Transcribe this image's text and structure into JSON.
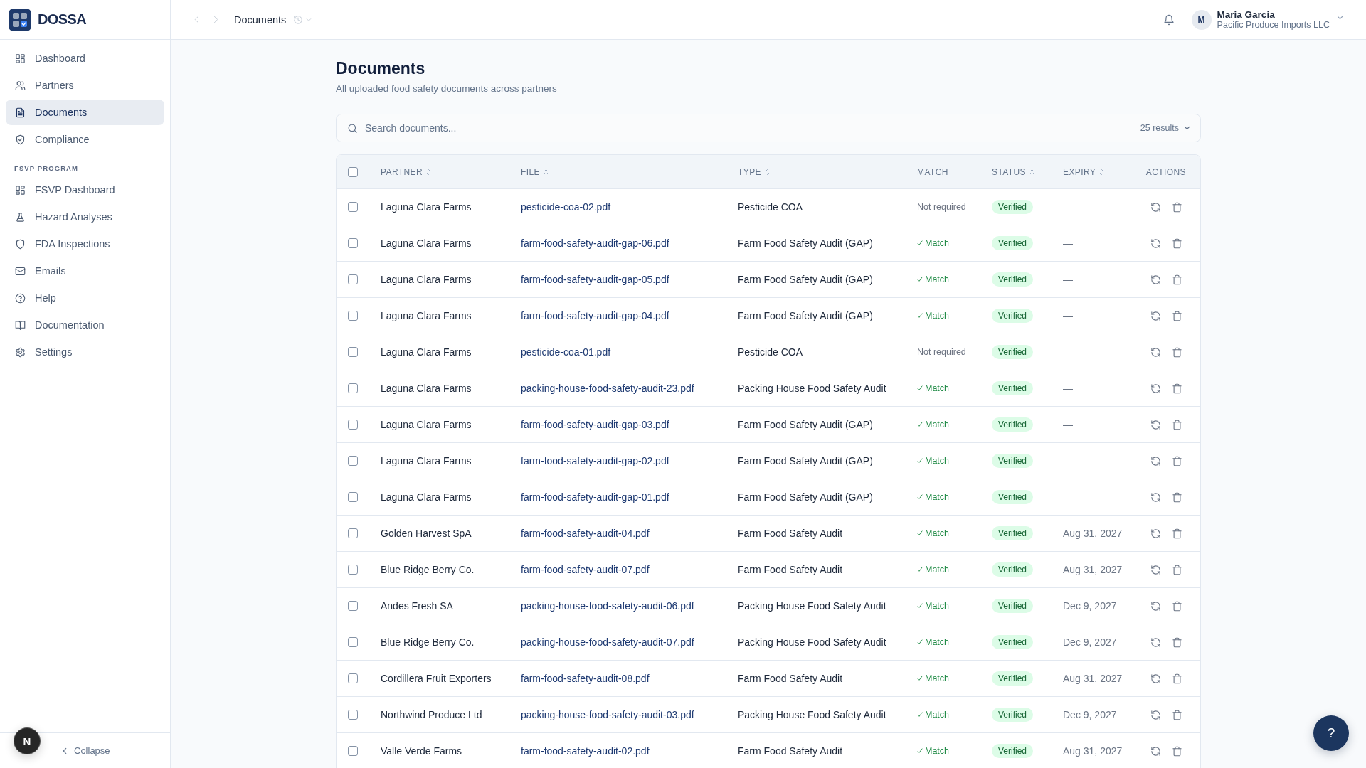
{
  "sidebar": {
    "logo": "DOSSA",
    "groups": [
      {
        "items": [
          {
            "label": "Dashboard",
            "selected": false
          },
          {
            "label": "Partners",
            "selected": false
          },
          {
            "label": "Documents",
            "selected": true
          },
          {
            "label": "Compliance",
            "selected": false
          }
        ]
      },
      {
        "label": "FSVP PROGRAM",
        "items": [
          {
            "label": "FSVP Dashboard",
            "selected": false
          },
          {
            "label": "Hazard Analyses",
            "selected": false
          },
          {
            "label": "FDA Inspections",
            "selected": false
          },
          {
            "label": "Emails",
            "selected": false
          },
          {
            "label": "Help",
            "selected": false
          },
          {
            "label": "Documentation",
            "selected": false
          },
          {
            "label": "Settings",
            "selected": false
          }
        ]
      }
    ],
    "collapse": "Collapse"
  },
  "header": {
    "breadcrumb": "Documents",
    "user": {
      "initial": "M",
      "name": "Maria Garcia",
      "organization": "Pacific Produce Imports LLC"
    }
  },
  "page": {
    "title": "Documents",
    "subtitle": "All uploaded food safety documents across partners"
  },
  "search": {
    "placeholder": "Search documents...",
    "results": "25 results"
  },
  "table": {
    "select_all_checked": false,
    "columns": [
      {
        "label": "PARTNER",
        "sortable": true
      },
      {
        "label": "FILE",
        "sortable": true
      },
      {
        "label": "TYPE",
        "sortable": true
      },
      {
        "label": "MATCH",
        "sortable": false
      },
      {
        "label": "STATUS",
        "sortable": true
      },
      {
        "label": "EXPIRY",
        "sortable": true
      },
      {
        "label": "ACTIONS",
        "sortable": false
      }
    ],
    "rows": [
      {
        "checked": false,
        "partner": "Laguna Clara Farms",
        "file": "pesticide-coa-02.pdf",
        "type": "Pesticide COA",
        "match": {
          "kind": "not_required",
          "label": "Not required"
        },
        "status": "Verified",
        "expiry": "—"
      },
      {
        "checked": false,
        "partner": "Laguna Clara Farms",
        "file": "farm-food-safety-audit-gap-06.pdf",
        "type": "Farm Food Safety Audit (GAP)",
        "match": {
          "kind": "match",
          "label": "Match"
        },
        "status": "Verified",
        "expiry": "—"
      },
      {
        "checked": false,
        "partner": "Laguna Clara Farms",
        "file": "farm-food-safety-audit-gap-05.pdf",
        "type": "Farm Food Safety Audit (GAP)",
        "match": {
          "kind": "match",
          "label": "Match"
        },
        "status": "Verified",
        "expiry": "—"
      },
      {
        "checked": false,
        "partner": "Laguna Clara Farms",
        "file": "farm-food-safety-audit-gap-04.pdf",
        "type": "Farm Food Safety Audit (GAP)",
        "match": {
          "kind": "match",
          "label": "Match"
        },
        "status": "Verified",
        "expiry": "—"
      },
      {
        "checked": false,
        "partner": "Laguna Clara Farms",
        "file": "pesticide-coa-01.pdf",
        "type": "Pesticide COA",
        "match": {
          "kind": "not_required",
          "label": "Not required"
        },
        "status": "Verified",
        "expiry": "—"
      },
      {
        "checked": false,
        "partner": "Laguna Clara Farms",
        "file": "packing-house-food-safety-audit-23.pdf",
        "type": "Packing House Food Safety Audit",
        "match": {
          "kind": "match",
          "label": "Match"
        },
        "status": "Verified",
        "expiry": "—"
      },
      {
        "checked": false,
        "partner": "Laguna Clara Farms",
        "file": "farm-food-safety-audit-gap-03.pdf",
        "type": "Farm Food Safety Audit (GAP)",
        "match": {
          "kind": "match",
          "label": "Match"
        },
        "status": "Verified",
        "expiry": "—"
      },
      {
        "checked": false,
        "partner": "Laguna Clara Farms",
        "file": "farm-food-safety-audit-gap-02.pdf",
        "type": "Farm Food Safety Audit (GAP)",
        "match": {
          "kind": "match",
          "label": "Match"
        },
        "status": "Verified",
        "expiry": "—"
      },
      {
        "checked": false,
        "partner": "Laguna Clara Farms",
        "file": "farm-food-safety-audit-gap-01.pdf",
        "type": "Farm Food Safety Audit (GAP)",
        "match": {
          "kind": "match",
          "label": "Match"
        },
        "status": "Verified",
        "expiry": "—"
      },
      {
        "checked": false,
        "partner": "Golden Harvest SpA",
        "file": "farm-food-safety-audit-04.pdf",
        "type": "Farm Food Safety Audit",
        "match": {
          "kind": "match",
          "label": "Match"
        },
        "status": "Verified",
        "expiry": "Aug 31, 2027"
      },
      {
        "checked": false,
        "partner": "Blue Ridge Berry Co.",
        "file": "farm-food-safety-audit-07.pdf",
        "type": "Farm Food Safety Audit",
        "match": {
          "kind": "match",
          "label": "Match"
        },
        "status": "Verified",
        "expiry": "Aug 31, 2027"
      },
      {
        "checked": false,
        "partner": "Andes Fresh SA",
        "file": "packing-house-food-safety-audit-06.pdf",
        "type": "Packing House Food Safety Audit",
        "match": {
          "kind": "match",
          "label": "Match"
        },
        "status": "Verified",
        "expiry": "Dec 9, 2027"
      },
      {
        "checked": false,
        "partner": "Blue Ridge Berry Co.",
        "file": "packing-house-food-safety-audit-07.pdf",
        "type": "Packing House Food Safety Audit",
        "match": {
          "kind": "match",
          "label": "Match"
        },
        "status": "Verified",
        "expiry": "Dec 9, 2027"
      },
      {
        "checked": false,
        "partner": "Cordillera Fruit Exporters",
        "file": "farm-food-safety-audit-08.pdf",
        "type": "Farm Food Safety Audit",
        "match": {
          "kind": "match",
          "label": "Match"
        },
        "status": "Verified",
        "expiry": "Aug 31, 2027"
      },
      {
        "checked": false,
        "partner": "Northwind Produce Ltd",
        "file": "packing-house-food-safety-audit-03.pdf",
        "type": "Packing House Food Safety Audit",
        "match": {
          "kind": "match",
          "label": "Match"
        },
        "status": "Verified",
        "expiry": "Dec 9, 2027"
      },
      {
        "checked": false,
        "partner": "Valle Verde Farms",
        "file": "farm-food-safety-audit-02.pdf",
        "type": "Farm Food Safety Audit",
        "match": {
          "kind": "match",
          "label": "Match"
        },
        "status": "Verified",
        "expiry": "Aug 31, 2027"
      }
    ]
  },
  "floating_button": "N",
  "help_button": "?"
}
